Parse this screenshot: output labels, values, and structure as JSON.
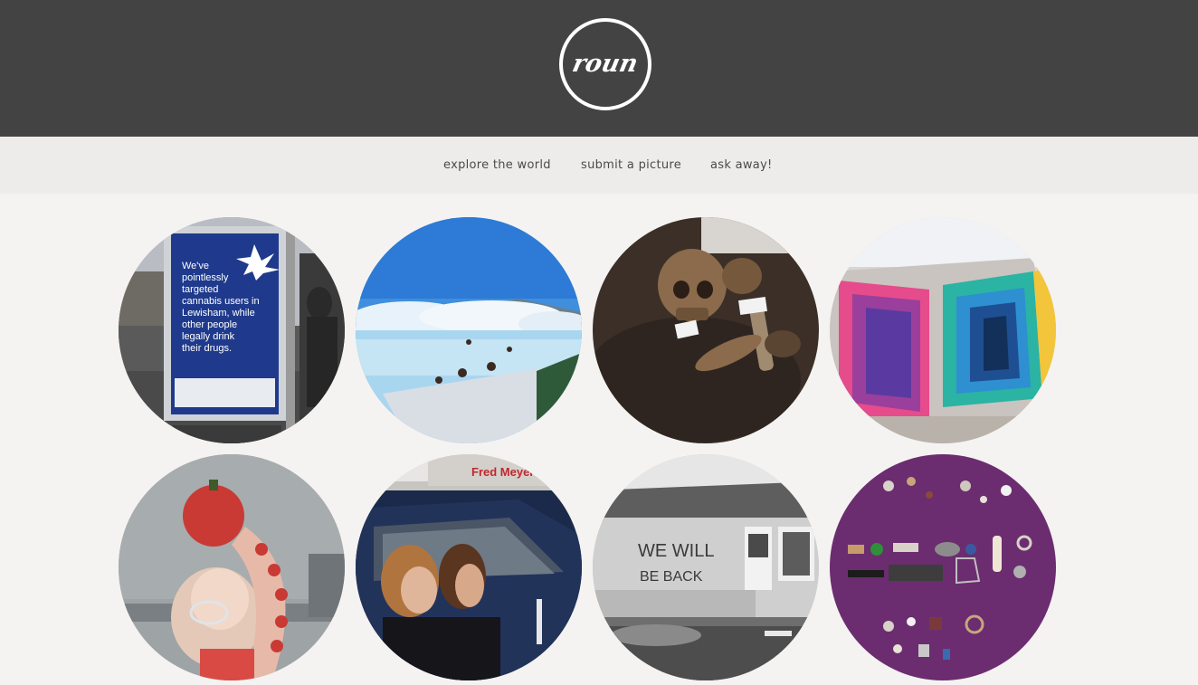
{
  "header": {
    "logo_text": "roun",
    "background": "#434343"
  },
  "nav": {
    "items": [
      {
        "label": "explore the world"
      },
      {
        "label": "submit a picture"
      },
      {
        "label": "ask away!"
      }
    ]
  },
  "gallery": {
    "items": [
      {
        "subject": "bus-stop-poster",
        "poster_lines": [
          "We've",
          "pointlessly",
          "targeted",
          "cannabis users in",
          "Lewisham, while",
          "other people",
          "legally drink",
          "their drugs."
        ],
        "poster_color": "#1f3a8c"
      },
      {
        "subject": "blue-lagoon",
        "accent": "#3f8fdc"
      },
      {
        "subject": "excavated-skull",
        "accent": "#3b2f28"
      },
      {
        "subject": "colorful-mural",
        "accent": "#e64b8c"
      },
      {
        "subject": "tomato-headpiece",
        "accent": "#c93a34"
      },
      {
        "subject": "car-passengers",
        "sign_text": "Fred Meyer",
        "accent": "#1b2a4a"
      },
      {
        "subject": "graffiti-house",
        "graffiti_lines": [
          "WE WILL",
          "BE BACK"
        ],
        "accent": "#6e6e6e"
      },
      {
        "subject": "objects-flatlay",
        "accent": "#6b2d6f"
      }
    ]
  }
}
